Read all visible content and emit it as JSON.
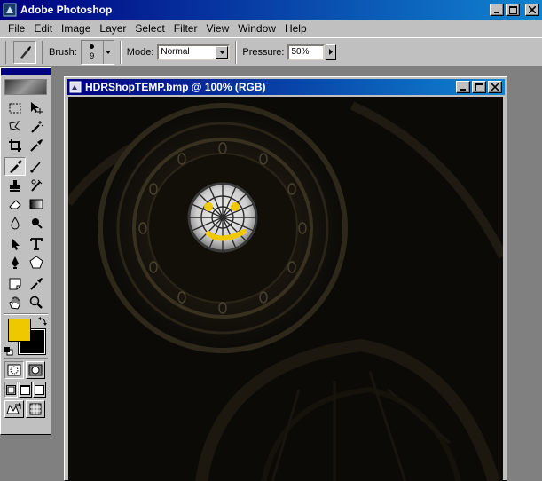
{
  "app": {
    "title": "Adobe Photoshop"
  },
  "menu": [
    "File",
    "Edit",
    "Image",
    "Layer",
    "Select",
    "Filter",
    "View",
    "Window",
    "Help"
  ],
  "options": {
    "brush_label": "Brush:",
    "brush_size": "9",
    "mode_label": "Mode:",
    "mode_value": "Normal",
    "pressure_label": "Pressure:",
    "pressure_value": "50%"
  },
  "colors": {
    "foreground": "#f0c800",
    "background": "#000000",
    "titlebar": "#000080"
  },
  "toolbox": {
    "tools": [
      [
        "marquee-icon",
        "move-icon"
      ],
      [
        "lasso-icon",
        "magic-wand-icon"
      ],
      [
        "crop-icon",
        "eyedropper-icon"
      ],
      [
        "airbrush-icon",
        "paintbrush-icon"
      ],
      [
        "rubber-stamp-icon",
        "history-brush-icon"
      ],
      [
        "eraser-icon",
        "gradient-icon"
      ],
      [
        "blur-icon",
        "burn-icon"
      ],
      [
        "path-select-icon",
        "type-icon"
      ],
      [
        "pen-icon",
        "shape-icon"
      ],
      [
        "notes-icon",
        "color-sampler-icon"
      ],
      [
        "hand-icon",
        "zoom-icon"
      ]
    ],
    "active_tool": "airbrush-icon"
  },
  "document": {
    "title": "HDRShopTEMP.bmp @ 100% (RGB)"
  }
}
